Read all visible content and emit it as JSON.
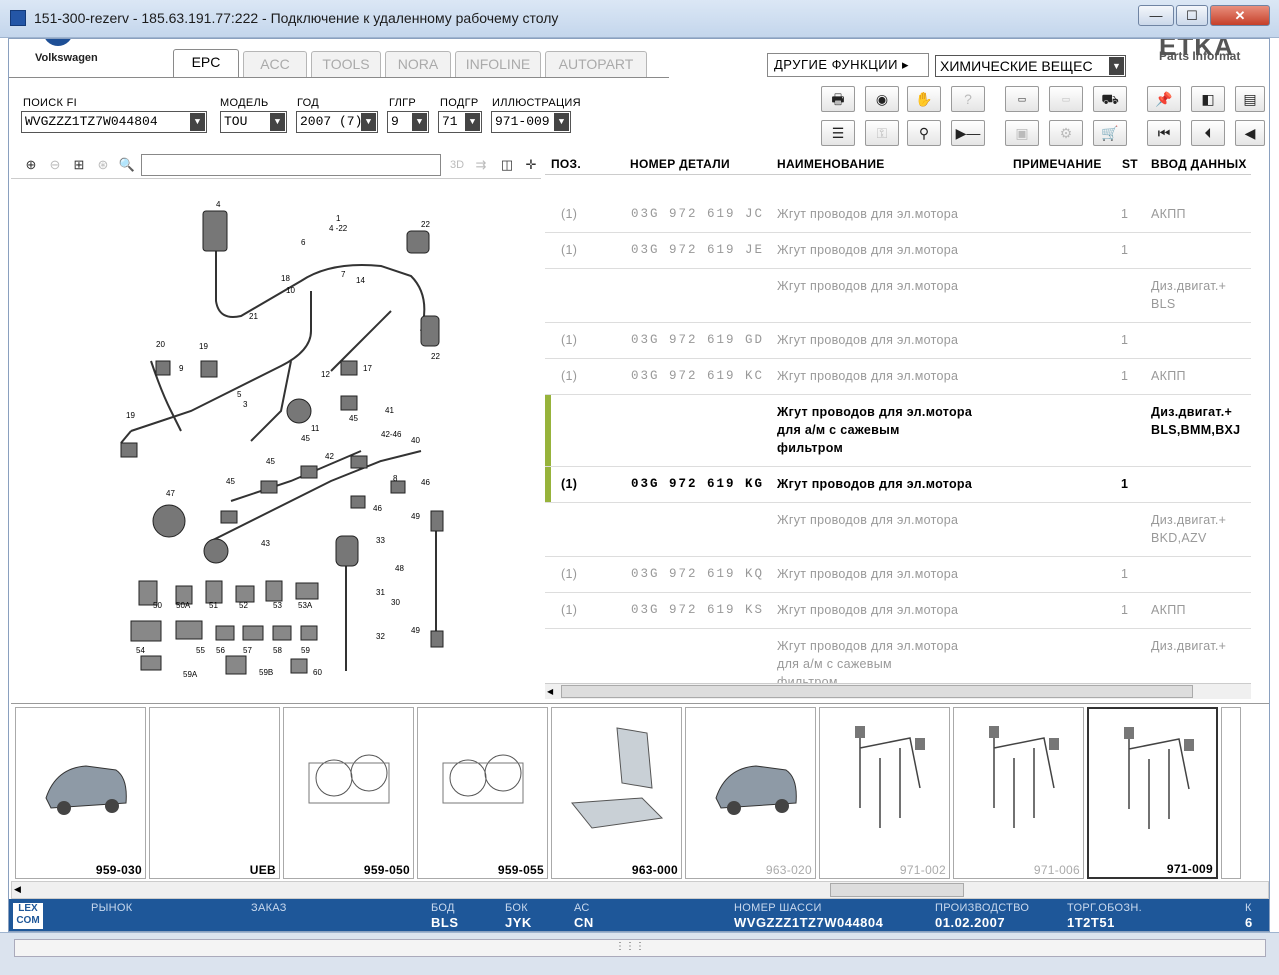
{
  "window": {
    "title": "151-300-rezerv - 185.63.191.77:222 - Подключение к удаленному рабочему столу",
    "minimize": "—",
    "maximize": "☐",
    "close": "✕"
  },
  "brand": {
    "label": "Volkswagen",
    "etka": "ETKA",
    "etka_sub": "Parts Informat"
  },
  "tabs": [
    "EPC",
    "ACC",
    "TOOLS",
    "NORA",
    "INFOLINE",
    "AUTOPART"
  ],
  "active_tab": "EPC",
  "other_functions": "ДРУГИЕ ФУНКЦИИ ▸",
  "chemicals": "ХИМИЧЕСКИЕ ВЕЩЕС",
  "fields": {
    "search_fi": {
      "label": "ПОИСК FI",
      "value": "WVGZZZ1TZ7W044804"
    },
    "model": {
      "label": "МОДЕЛЬ",
      "value": "TOU"
    },
    "year": {
      "label": "ГОД",
      "value": "2007 (7)"
    },
    "main_group": {
      "label": "ГЛГР",
      "value": "9"
    },
    "sub_group": {
      "label": "ПОДГР",
      "value": "71"
    },
    "illustration": {
      "label": "ИЛЛЮСТРАЦИЯ",
      "value": "971-009"
    }
  },
  "table": {
    "headers": {
      "pos": "ПОЗ.",
      "part": "НОМЕР ДЕТАЛИ",
      "name": "НАИМЕНОВАНИЕ",
      "note": "ПРИМЕЧАНИЕ",
      "st": "ST",
      "data": "ВВОД ДАННЫХ"
    },
    "rows": [
      {
        "pos": "(1)",
        "part": "03G 972 619 JC",
        "name": "Жгут проводов для эл.мотора",
        "st": "1",
        "data": "АКПП"
      },
      {
        "pos": "(1)",
        "part": "03G 972 619 JE",
        "name": "Жгут проводов для эл.мотора",
        "st": "1",
        "data": ""
      },
      {
        "pos": "",
        "part": "",
        "name": "Жгут проводов для эл.мотора",
        "st": "",
        "data": "Диз.двигат.+\nBLS"
      },
      {
        "pos": "(1)",
        "part": "03G 972 619 GD",
        "name": "Жгут проводов для эл.мотора",
        "st": "1",
        "data": ""
      },
      {
        "pos": "(1)",
        "part": "03G 972 619 KC",
        "name": "Жгут проводов для эл.мотора",
        "st": "1",
        "data": "АКПП"
      },
      {
        "pos": "",
        "part": "",
        "name": "Жгут проводов для эл.мотора\nдля а/м с сажевым\nфильтром",
        "st": "",
        "data": "Диз.двигат.+\nBLS,BMM,BXJ"
      },
      {
        "pos": "(1)",
        "part": "03G 972 619 KG",
        "name": "Жгут проводов для эл.мотора",
        "st": "1",
        "data": ""
      },
      {
        "pos": "",
        "part": "",
        "name": "Жгут проводов для эл.мотора",
        "st": "",
        "data": "Диз.двигат.+\nBKD,AZV"
      },
      {
        "pos": "(1)",
        "part": "03G 972 619 KQ",
        "name": "Жгут проводов для эл.мотора",
        "st": "1",
        "data": ""
      },
      {
        "pos": "(1)",
        "part": "03G 972 619 KS",
        "name": "Жгут проводов для эл.мотора",
        "st": "1",
        "data": "АКПП"
      },
      {
        "pos": "",
        "part": "",
        "name": "Жгут проводов для эл.мотора\nдля а/м с сажевым\nфильтром",
        "st": "",
        "data": "Диз.двигат.+"
      }
    ]
  },
  "thumbnails": [
    {
      "label": "959-030",
      "dim": false
    },
    {
      "label": "UEB",
      "dim": false
    },
    {
      "label": "959-050",
      "dim": false
    },
    {
      "label": "959-055",
      "dim": false
    },
    {
      "label": "963-000",
      "dim": false
    },
    {
      "label": "963-020",
      "dim": true
    },
    {
      "label": "971-002",
      "dim": true
    },
    {
      "label": "971-006",
      "dim": true
    },
    {
      "label": "971-009",
      "dim": false
    }
  ],
  "status": {
    "market": {
      "label": "РЫНОК",
      "value": ""
    },
    "order": {
      "label": "ЗАКАЗ",
      "value": ""
    },
    "bod": {
      "label": "БОД",
      "value": "BLS"
    },
    "bok": {
      "label": "БОК",
      "value": "JYK"
    },
    "ac": {
      "label": "АС",
      "value": "CN"
    },
    "chassis": {
      "label": "НОМЕР ШАССИ",
      "value": "WVGZZZ1TZ7W044804"
    },
    "production": {
      "label": "ПРОИЗВОДСТВО",
      "value": "01.02.2007"
    },
    "trade": {
      "label": "ТОРГ.ОБОЗН.",
      "value": "1T2T51"
    },
    "k": {
      "label": "К",
      "value": "6"
    },
    "lexcom": "LEX\nCOM"
  },
  "illustration_labels": [
    "1",
    "4-22",
    "4",
    "6",
    "22",
    "18",
    "10",
    "7",
    "14",
    "21",
    "20",
    "19",
    "9",
    "12",
    "17",
    "22",
    "5",
    "3",
    "11",
    "41",
    "45",
    "42-46",
    "40",
    "45",
    "42",
    "8",
    "46",
    "47",
    "45",
    "43",
    "46",
    "49",
    "33",
    "31",
    "48",
    "30",
    "32",
    "49",
    "50",
    "50A",
    "51",
    "52",
    "53",
    "53A",
    "54",
    "55",
    "56",
    "57",
    "58",
    "59",
    "59A",
    "59B",
    "60"
  ]
}
